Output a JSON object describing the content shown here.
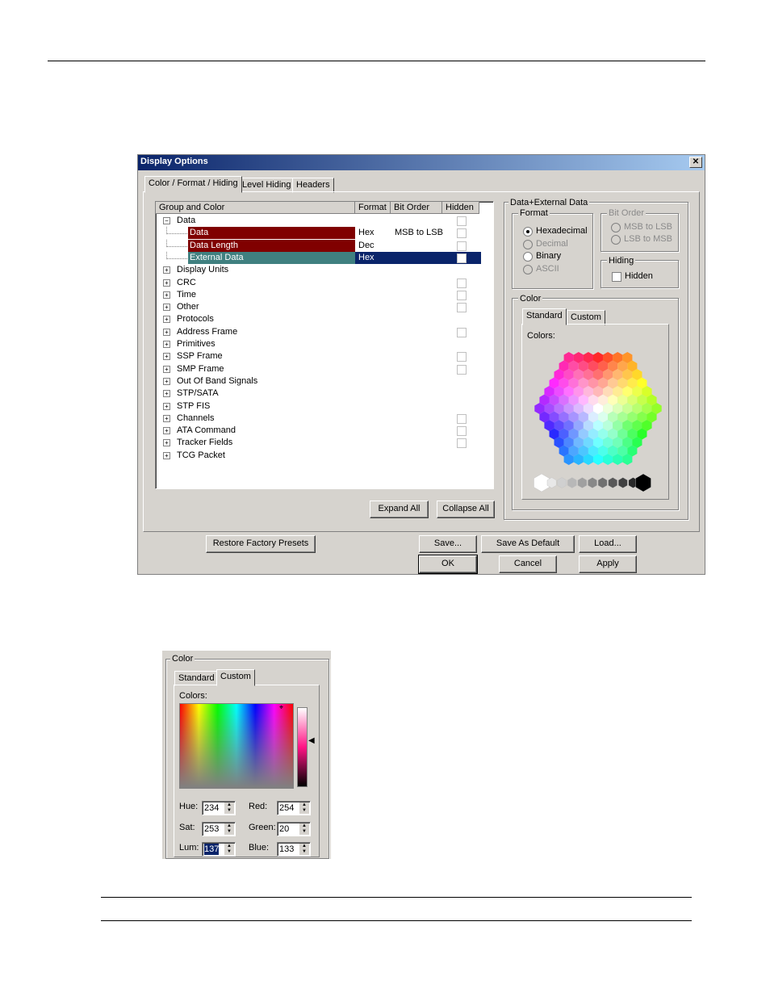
{
  "dialog": {
    "title": "Display Options",
    "close_glyph": "✕",
    "tabs": [
      "Color / Format / Hiding",
      "Level Hiding",
      "Headers"
    ],
    "grid": {
      "columns": [
        "Group and Color",
        "Format",
        "Bit Order",
        "Hidden"
      ],
      "rows": [
        {
          "label": "Data",
          "level": 0,
          "expander": "−",
          "format": "",
          "bit_order": "",
          "hidden_box": true
        },
        {
          "label": "Data",
          "level": 1,
          "format": "Hex",
          "bit_order": "MSB to LSB",
          "hidden_box": true,
          "bg": "#800000"
        },
        {
          "label": "Data Length",
          "level": 1,
          "format": "Dec",
          "bit_order": "",
          "hidden_box": true,
          "bg": "#800000"
        },
        {
          "label": "External Data",
          "level": 1,
          "format": "Hex",
          "bit_order": "",
          "hidden_box": true,
          "bg": "#408080",
          "selected": true
        },
        {
          "label": "Display Units",
          "level": 0,
          "expander": "+",
          "hidden_box": false
        },
        {
          "label": "CRC",
          "level": 0,
          "expander": "+",
          "hidden_box": true
        },
        {
          "label": "Time",
          "level": 0,
          "expander": "+",
          "hidden_box": true
        },
        {
          "label": "Other",
          "level": 0,
          "expander": "+",
          "hidden_box": true
        },
        {
          "label": "Protocols",
          "level": 0,
          "expander": "+",
          "hidden_box": false
        },
        {
          "label": "Address Frame",
          "level": 0,
          "expander": "+",
          "hidden_box": true
        },
        {
          "label": "Primitives",
          "level": 0,
          "expander": "+",
          "hidden_box": false
        },
        {
          "label": "SSP Frame",
          "level": 0,
          "expander": "+",
          "hidden_box": true
        },
        {
          "label": "SMP Frame",
          "level": 0,
          "expander": "+",
          "hidden_box": true
        },
        {
          "label": "Out Of Band Signals",
          "level": 0,
          "expander": "+",
          "hidden_box": false
        },
        {
          "label": "STP/SATA",
          "level": 0,
          "expander": "+",
          "hidden_box": false
        },
        {
          "label": "STP FIS",
          "level": 0,
          "expander": "+",
          "hidden_box": false
        },
        {
          "label": "Channels",
          "level": 0,
          "expander": "+",
          "hidden_box": true
        },
        {
          "label": "ATA Command",
          "level": 0,
          "expander": "+",
          "hidden_box": true
        },
        {
          "label": "Tracker Fields",
          "level": 0,
          "expander": "+",
          "hidden_box": true
        },
        {
          "label": "TCG Packet",
          "level": 0,
          "expander": "+",
          "hidden_box": false
        }
      ]
    },
    "expand_all": "Expand All",
    "collapse_all": "Collapse All",
    "right": {
      "group_title": "Data+External Data",
      "format_title": "Format",
      "format_options": [
        {
          "label": "Hexadecimal",
          "checked": true,
          "enabled": true
        },
        {
          "label": "Decimal",
          "checked": false,
          "enabled": false
        },
        {
          "label": "Binary",
          "checked": false,
          "enabled": true
        },
        {
          "label": "ASCII",
          "checked": false,
          "enabled": false
        }
      ],
      "bitorder_title": "Bit Order",
      "bitorder_options": [
        "MSB to LSB",
        "LSB to MSB"
      ],
      "hiding_title": "Hiding",
      "hidden_label": "Hidden",
      "color_title": "Color",
      "color_tabs": [
        "Standard",
        "Custom"
      ],
      "colors_label": "Colors:"
    },
    "buttons": {
      "restore": "Restore Factory Presets",
      "save": "Save...",
      "save_default": "Save As Default",
      "load": "Load...",
      "ok": "OK",
      "cancel": "Cancel",
      "apply": "Apply"
    }
  },
  "custom_color": {
    "title": "Color",
    "tabs": [
      "Standard",
      "Custom"
    ],
    "colors_label": "Colors:",
    "fields": {
      "hue_label": "Hue:",
      "hue": "234",
      "sat_label": "Sat:",
      "sat": "253",
      "lum_label": "Lum:",
      "lum": "137",
      "red_label": "Red:",
      "red": "254",
      "green_label": "Green:",
      "green": "20",
      "blue_label": "Blue:",
      "blue": "133"
    }
  }
}
